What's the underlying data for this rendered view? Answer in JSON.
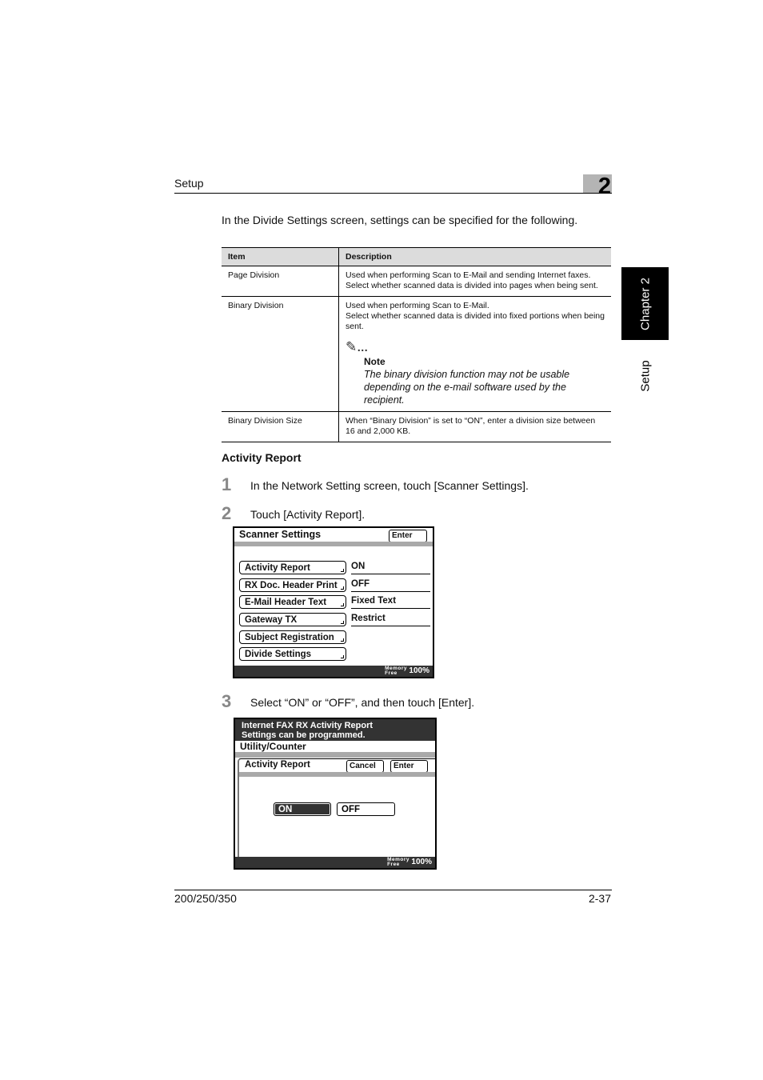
{
  "header": {
    "section_title": "Setup",
    "chapter_number": "2"
  },
  "side_tabs": {
    "chapter": "Chapter 2",
    "section": "Setup"
  },
  "intro": "In the Divide Settings screen, settings can be specified for the following.",
  "table": {
    "columns": [
      "Item",
      "Description"
    ],
    "rows": [
      {
        "item": "Page Division",
        "description": [
          "Used when performing Scan to E-Mail and sending Internet faxes.",
          "Select whether scanned data is divided into pages when being sent."
        ]
      },
      {
        "item": "Binary Division",
        "description": [
          "Used when performing Scan to E-Mail.",
          "Select whether scanned data is divided into fixed portions when being sent."
        ],
        "note": {
          "icon": "pencil-note-icon",
          "label": "Note",
          "text": "The binary division function may not be usable depending on the e-mail software used by the recipient."
        }
      },
      {
        "item": "Binary Division Size",
        "description": [
          "When “Binary Division” is set to “ON”, enter a division size between 16 and 2,000 KB."
        ]
      }
    ]
  },
  "section_heading": "Activity Report",
  "steps": [
    {
      "number": "1",
      "text": "In the Network Setting screen, touch [Scanner Settings]."
    },
    {
      "number": "2",
      "text": "Touch [Activity Report]."
    },
    {
      "number": "3",
      "text": "Select “ON” or “OFF”, and then touch [Enter]."
    }
  ],
  "screen_scanner_settings": {
    "title": "Scanner Settings",
    "enter_label": "Enter",
    "items": [
      {
        "label": "Activity Report",
        "value": "ON"
      },
      {
        "label": "RX Doc. Header Print",
        "value": "OFF"
      },
      {
        "label": "E-Mail Header Text",
        "value": "Fixed Text"
      },
      {
        "label": "Gateway TX",
        "value": "Restrict"
      },
      {
        "label": "Subject Registration",
        "value": ""
      },
      {
        "label": "Divide Settings",
        "value": ""
      }
    ],
    "memory_label_1": "Memory",
    "memory_label_2": "Free",
    "memory_value": "100%"
  },
  "screen_activity_report": {
    "message_line_1": "Internet FAX RX Activity Report",
    "message_line_2": "Settings can be programmed.",
    "breadcrumb": "Utility/Counter",
    "panel_title": "Activity Report",
    "cancel_label": "Cancel",
    "enter_label": "Enter",
    "on_label": "ON",
    "off_label": "OFF",
    "selected": "ON",
    "memory_label_1": "Memory",
    "memory_label_2": "Free",
    "memory_value": "100%"
  },
  "footer": {
    "model": "200/250/350",
    "page": "2-37"
  }
}
